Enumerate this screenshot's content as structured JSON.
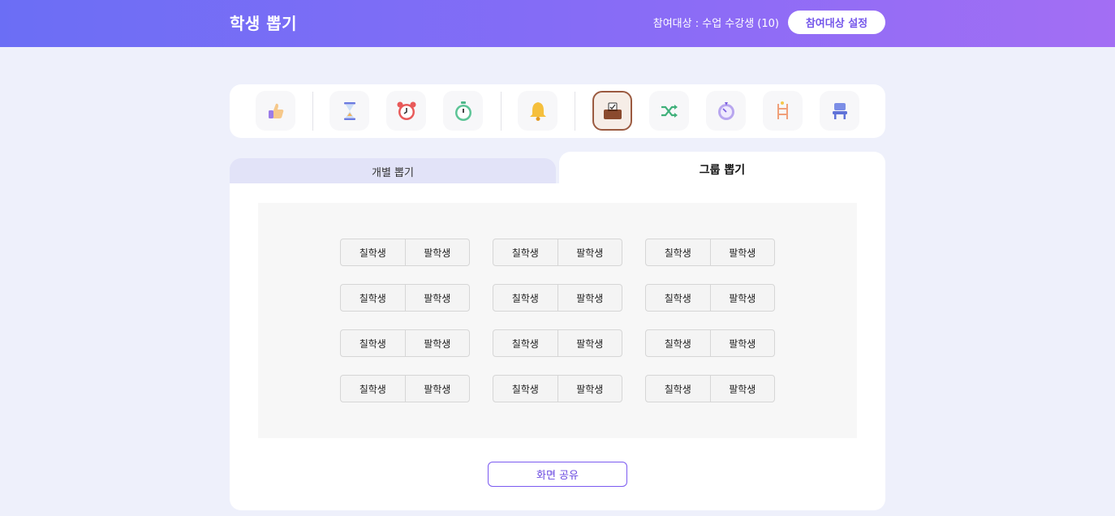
{
  "header": {
    "title": "학생 뽑기",
    "participants_text": "참여대상 : 수업 수강생 (10)",
    "settings_button": "참여대상 설정"
  },
  "toolbar": {
    "tools": [
      {
        "icon": "thumbs-up-icon"
      },
      {
        "icon": "hourglass-icon"
      },
      {
        "icon": "alarm-clock-icon"
      },
      {
        "icon": "stopwatch-icon"
      },
      {
        "icon": "bell-icon"
      },
      {
        "icon": "ballot-box-icon",
        "active": true
      },
      {
        "icon": "shuffle-icon"
      },
      {
        "icon": "roulette-icon"
      },
      {
        "icon": "ladder-icon"
      },
      {
        "icon": "seat-chair-icon"
      }
    ]
  },
  "tabs": {
    "individual": "개별 뽑기",
    "group": "그룹 뽑기",
    "active": "group"
  },
  "groups": [
    [
      "칠학생",
      "팔학생"
    ],
    [
      "칠학생",
      "팔학생"
    ],
    [
      "칠학생",
      "팔학생"
    ],
    [
      "칠학생",
      "팔학생"
    ],
    [
      "칠학생",
      "팔학생"
    ],
    [
      "칠학생",
      "팔학생"
    ],
    [
      "칠학생",
      "팔학생"
    ],
    [
      "칠학생",
      "팔학생"
    ],
    [
      "칠학생",
      "팔학생"
    ],
    [
      "칠학생",
      "팔학생"
    ],
    [
      "칠학생",
      "팔학생"
    ],
    [
      "칠학생",
      "팔학생"
    ]
  ],
  "share_button": "화면 공유",
  "colors": {
    "accent": "#7355ea",
    "header_start": "#6b6ef5",
    "header_end": "#a36ef4",
    "active_tool_border": "#9b5a40"
  }
}
